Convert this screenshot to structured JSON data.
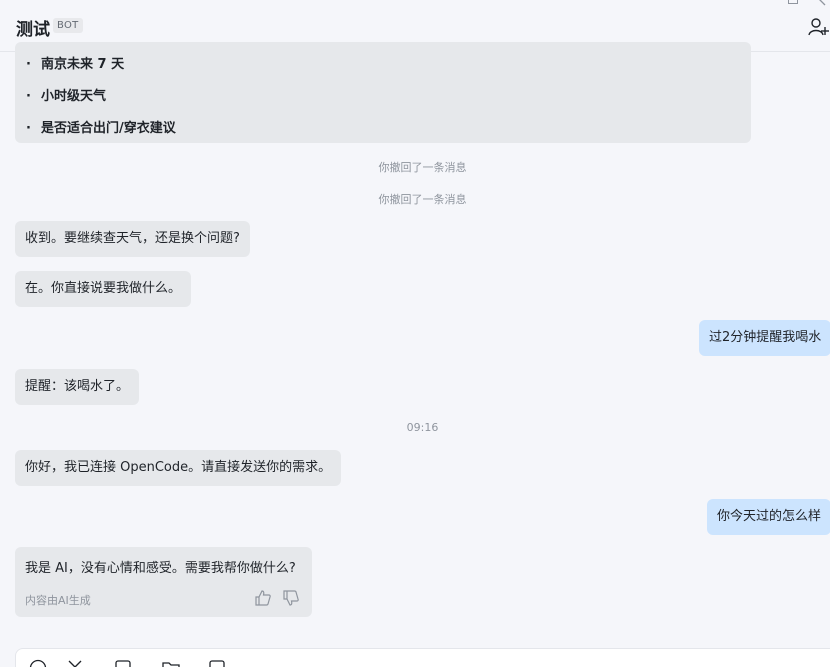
{
  "header": {
    "title": "测试",
    "badge": "BOT"
  },
  "messages": {
    "top_list": [
      "南京未来 7 天",
      "小时级天气",
      "是否适合出门/穿衣建议"
    ],
    "bullet": "·",
    "recall_1": "你撤回了一条消息",
    "recall_2": "你撤回了一条消息",
    "m1": "收到。要继续查天气，还是换个问题?",
    "m2": "在。你直接说要我做什么。",
    "m3": "过2分钟提醒我喝水",
    "m4": "提醒：该喝水了。",
    "time": "09:16",
    "m5": "你好，我已连接 OpenCode。请直接发送你的需求。",
    "m6": "你今天过的怎么样",
    "m7": "我是 AI，没有心情和感受。需要我帮你做什么?",
    "ai_note": "内容由AI生成"
  },
  "icons": {
    "add_member": "add-member-icon",
    "thumb_up": "thumb-up-icon",
    "thumb_down": "thumb-down-icon",
    "composer_tools": [
      "emoji-icon",
      "scissors-icon",
      "file-icon",
      "folder-icon",
      "chat-box-icon"
    ]
  },
  "colors": {
    "background": "#f5f6fa",
    "bot_bubble": "#e6e8eb",
    "user_bubble": "#cce4fe",
    "muted_text": "#8f959e"
  }
}
